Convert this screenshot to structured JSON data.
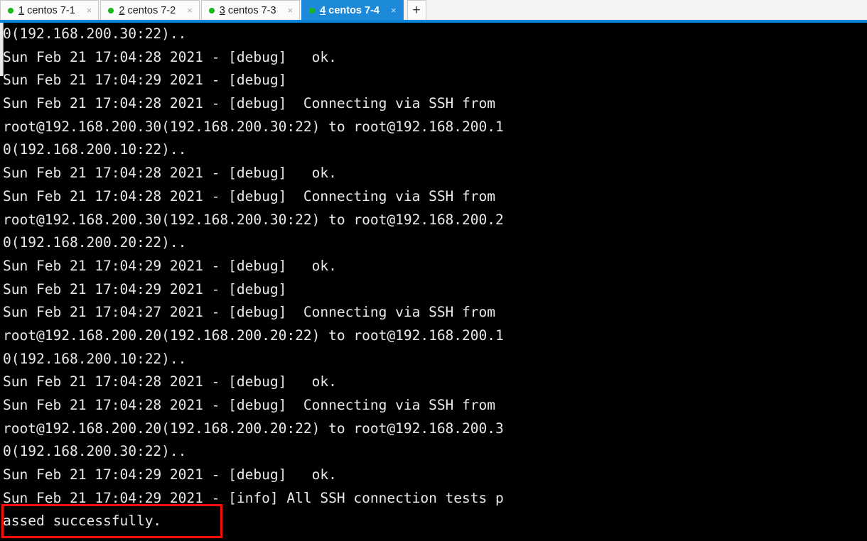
{
  "window": {
    "app": "terminal-tabbed-session",
    "background_color": "#000000",
    "accent_color": "#1c8ad8"
  },
  "tabbar": {
    "underline_color": "#0a84d8",
    "status_dot_color": "#18b818",
    "close_glyph": "×",
    "new_tab_label": "+",
    "tabs": [
      {
        "index": "1",
        "title": "centos 7-1",
        "active": false,
        "close": "×"
      },
      {
        "index": "2",
        "title": "centos 7-2",
        "active": false,
        "close": "×"
      },
      {
        "index": "3",
        "title": "centos 7-3",
        "active": false,
        "close": "×"
      },
      {
        "index": "4",
        "title": "centos 7-4",
        "active": true,
        "close": "×"
      }
    ]
  },
  "terminal": {
    "foreground_color": "#e8e8e8",
    "background_color": "#000000",
    "lines": [
      "0(192.168.200.30:22)..",
      "Sun Feb 21 17:04:28 2021 - [debug]   ok.",
      "Sun Feb 21 17:04:29 2021 - [debug]",
      "Sun Feb 21 17:04:28 2021 - [debug]  Connecting via SSH from",
      "root@192.168.200.30(192.168.200.30:22) to root@192.168.200.1",
      "0(192.168.200.10:22)..",
      "Sun Feb 21 17:04:28 2021 - [debug]   ok.",
      "Sun Feb 21 17:04:28 2021 - [debug]  Connecting via SSH from",
      "root@192.168.200.30(192.168.200.30:22) to root@192.168.200.2",
      "0(192.168.200.20:22)..",
      "Sun Feb 21 17:04:29 2021 - [debug]   ok.",
      "Sun Feb 21 17:04:29 2021 - [debug]",
      "Sun Feb 21 17:04:27 2021 - [debug]  Connecting via SSH from",
      "root@192.168.200.20(192.168.200.20:22) to root@192.168.200.1",
      "0(192.168.200.10:22)..",
      "Sun Feb 21 17:04:28 2021 - [debug]   ok.",
      "Sun Feb 21 17:04:28 2021 - [debug]  Connecting via SSH from",
      "root@192.168.200.20(192.168.200.20:22) to root@192.168.200.3",
      "0(192.168.200.30:22)..",
      "Sun Feb 21 17:04:29 2021 - [debug]   ok.",
      "Sun Feb 21 17:04:29 2021 - [info] All SSH connection tests p",
      "assed successfully."
    ]
  },
  "annotation": {
    "type": "rectangle-highlight",
    "color": "#fb0d07",
    "highlighted_text": "assed successfully."
  }
}
